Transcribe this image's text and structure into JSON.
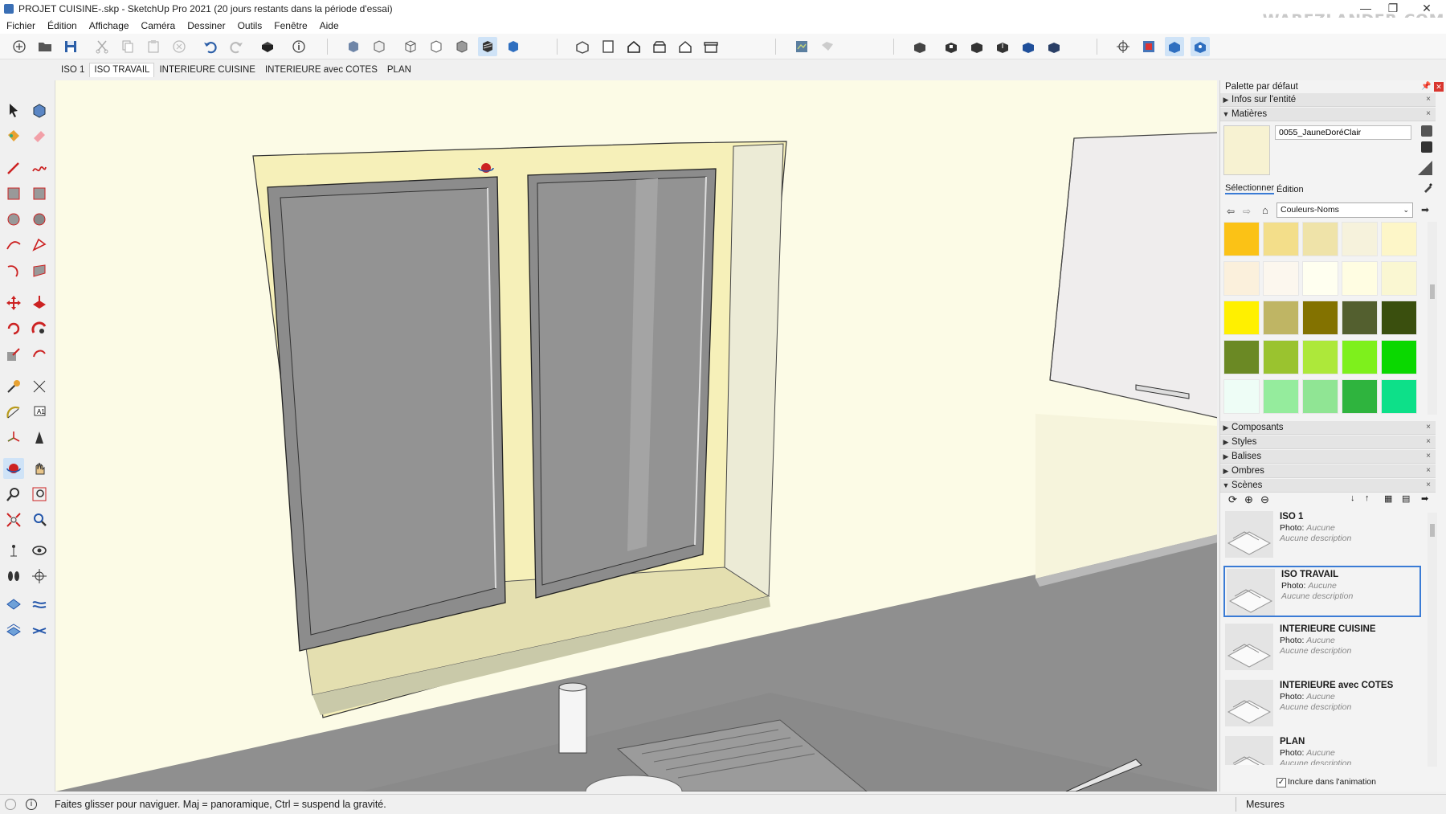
{
  "window": {
    "title": "PROJET CUISINE-.skp - SketchUp Pro 2021 (20 jours restants dans la période d'essai)",
    "watermark": "WAREZLANDER.COM",
    "minimize": "—",
    "restore": "❐",
    "close": "✕"
  },
  "menu": [
    "Fichier",
    "Édition",
    "Affichage",
    "Caméra",
    "Dessiner",
    "Outils",
    "Fenêtre",
    "Aide"
  ],
  "scene_tabs": [
    {
      "label": "ISO 1",
      "active": false
    },
    {
      "label": "ISO TRAVAIL",
      "active": true
    },
    {
      "label": "INTERIEURE CUISINE",
      "active": false
    },
    {
      "label": "INTERIEURE avec COTES",
      "active": false
    },
    {
      "label": "PLAN",
      "active": false
    }
  ],
  "right_panel": {
    "title": "Palette par défaut",
    "sections_top": [
      {
        "label": "Infos sur l'entité",
        "expanded": false
      },
      {
        "label": "Matières",
        "expanded": true
      }
    ],
    "material": {
      "name": "0055_JauneDoréClair",
      "color": "#f7f2d2",
      "tab_select": "Sélectionner",
      "tab_edit": "Édition",
      "library": "Couleurs-Noms"
    },
    "swatches": [
      "#fbc216",
      "#f3de8a",
      "#efe3a9",
      "#f6f2dc",
      "#fdf6c8",
      "#fbf0dc",
      "#fcf7ee",
      "#fffff0",
      "#fffde2",
      "#faf7d2",
      "#fff000",
      "#bfb564",
      "#837200",
      "#535f2f",
      "#3a4f0e",
      "#6b8924",
      "#9ac32f",
      "#ade83a",
      "#7ef01c",
      "#0ad800",
      "#eefdf6",
      "#95ec9d",
      "#90e594",
      "#2fb43e",
      "#0de089"
    ],
    "sections_mid": [
      {
        "label": "Composants",
        "expanded": false
      },
      {
        "label": "Styles",
        "expanded": false
      },
      {
        "label": "Balises",
        "expanded": false
      },
      {
        "label": "Ombres",
        "expanded": false
      },
      {
        "label": "Scènes",
        "expanded": true
      }
    ],
    "scenes": [
      {
        "name": "ISO 1",
        "photo_label": "Photo:",
        "photo_value": "Aucune",
        "description": "Aucune description",
        "active": false
      },
      {
        "name": "ISO TRAVAIL",
        "photo_label": "Photo:",
        "photo_value": "Aucune",
        "description": "Aucune description",
        "active": true
      },
      {
        "name": "INTERIEURE CUISINE",
        "photo_label": "Photo:",
        "photo_value": "Aucune",
        "description": "Aucune description",
        "active": false
      },
      {
        "name": "INTERIEURE avec COTES",
        "photo_label": "Photo:",
        "photo_value": "Aucune",
        "description": "Aucune description",
        "active": false
      },
      {
        "name": "PLAN",
        "photo_label": "Photo:",
        "photo_value": "Aucune",
        "description": "Aucune description",
        "active": false
      }
    ],
    "include_animation": "Inclure dans l'animation"
  },
  "status": {
    "hint": "Faites glisser pour naviguer. Maj = panoramique, Ctrl =  suspend la gravité.",
    "measurements_label": "Mesures"
  },
  "colors": {
    "wall": "#fcfbe6",
    "frame": "#f6f0b9",
    "glass": "#8f8f8f",
    "counter": "#969696",
    "accent": "#3a7bd5"
  }
}
